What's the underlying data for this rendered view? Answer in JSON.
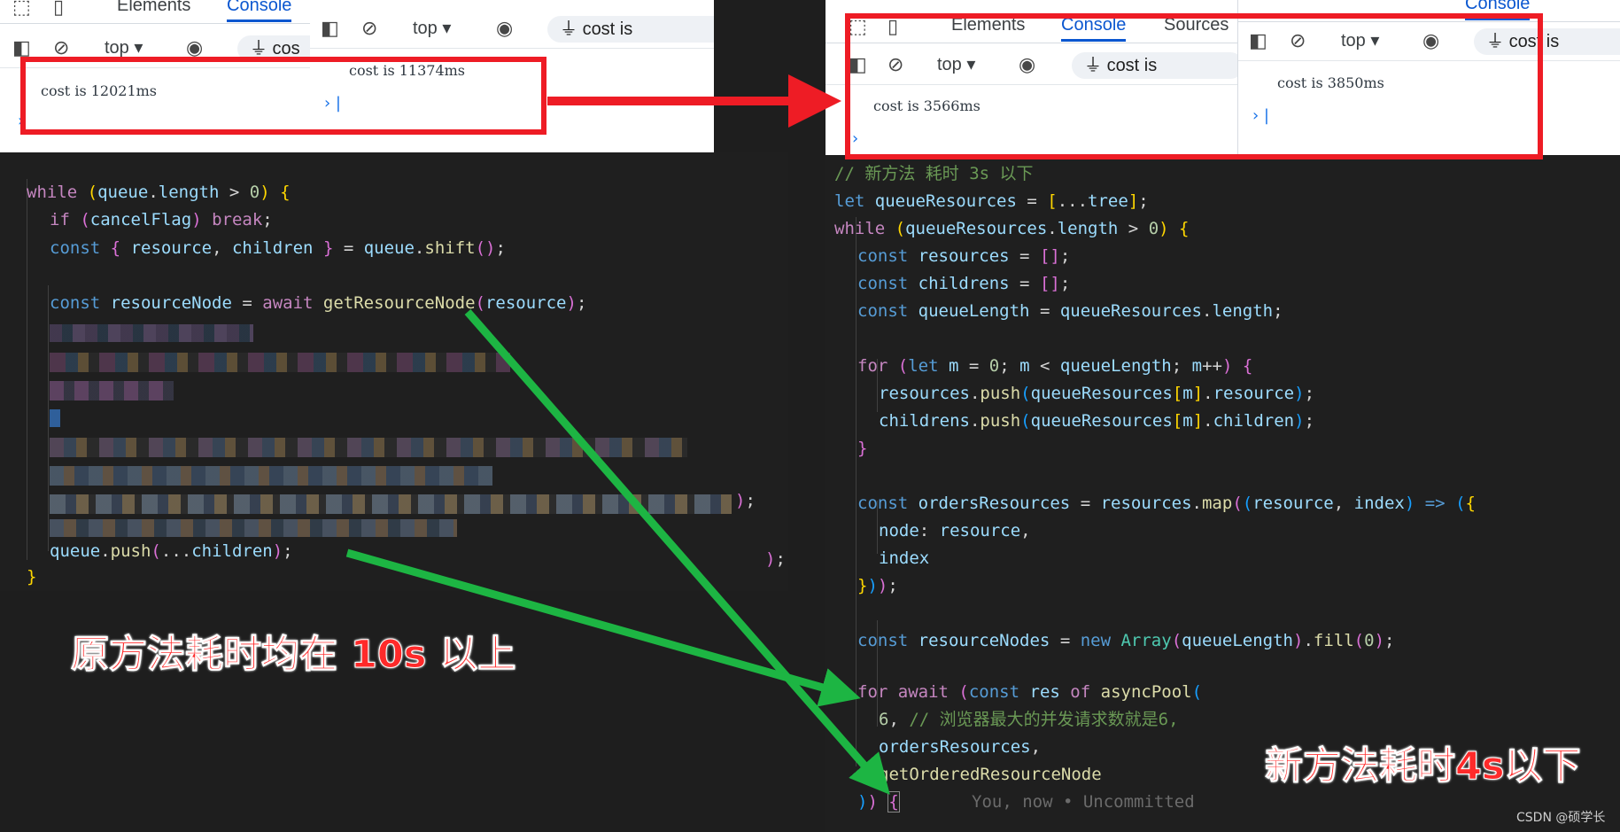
{
  "devtools": {
    "tabs": [
      "Elements",
      "Console",
      "Sources"
    ],
    "context": "top",
    "filter": "cost is",
    "panes": {
      "left_a": {
        "message": "cost is 12021ms"
      },
      "left_b": {
        "message": "cost is 11374ms"
      },
      "right_a": {
        "message": "cost is 3566ms"
      },
      "right_b": {
        "message": "cost is 3850ms"
      }
    }
  },
  "left_code": {
    "lines": [
      "while (queue.length > 0) {",
      "if (cancelFlag) break;",
      "const { resource, children } = queue.shift();",
      "const resourceNode = await getResourceNode(resource);",
      ");",
      "queue.push(...children);",
      "}",
      ");"
    ]
  },
  "right_code": {
    "comment_top": "// 新方法 耗时 3s 以下",
    "comment_pool": "// 浏览器最大的并发请求数就是6,",
    "blame": "You, now • Uncommitted"
  },
  "annotations": {
    "old_label": "原方法耗时均在 10s 以上",
    "new_label": "新方法耗时4s以下",
    "watermark": "CSDN @硕学长"
  },
  "colors": {
    "highlight": "#ee1c25",
    "arrow": "#1db543",
    "accent": "#0b57d0"
  }
}
